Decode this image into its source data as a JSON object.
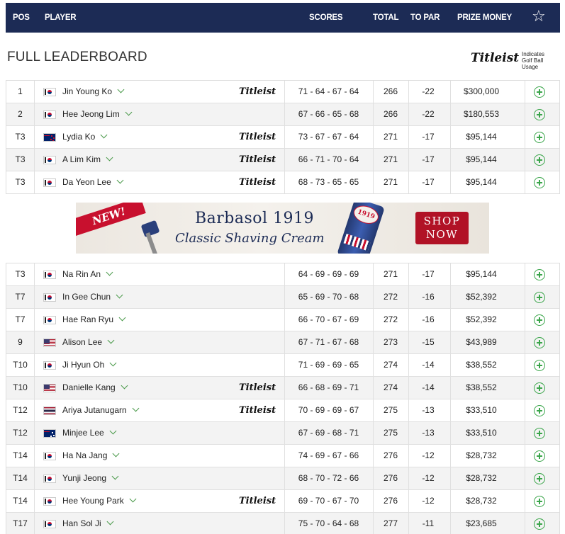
{
  "header": {
    "pos": "POS",
    "player": "PLAYER",
    "scores": "SCORES",
    "total": "TOTAL",
    "to_par": "TO PAR",
    "prize_money": "PRIZE MONEY",
    "favorite_icon": "star-outline-icon",
    "background": "#1c2b55"
  },
  "title": "FULL LEADERBOARD",
  "sponsor": {
    "logo_text": "Titleist",
    "note_line1": "Indicates",
    "note_line2": "Golf Ball Usage"
  },
  "accent_color": "#3aa54a",
  "leaderboard_top": [
    {
      "pos": "1",
      "flag": "kr",
      "name": "Jin Young Ko",
      "titleist": true,
      "scores": "71 - 64 - 67 - 64",
      "total": "266",
      "to_par": "-22",
      "prize": "$300,000"
    },
    {
      "pos": "2",
      "flag": "kr",
      "name": "Hee Jeong Lim",
      "titleist": false,
      "scores": "67 - 66 - 65 - 68",
      "total": "266",
      "to_par": "-22",
      "prize": "$180,553"
    },
    {
      "pos": "T3",
      "flag": "nz",
      "name": "Lydia Ko",
      "titleist": true,
      "scores": "73 - 67 - 67 - 64",
      "total": "271",
      "to_par": "-17",
      "prize": "$95,144"
    },
    {
      "pos": "T3",
      "flag": "kr",
      "name": "A Lim Kim",
      "titleist": true,
      "scores": "66 - 71 - 70 - 64",
      "total": "271",
      "to_par": "-17",
      "prize": "$95,144"
    },
    {
      "pos": "T3",
      "flag": "kr",
      "name": "Da Yeon Lee",
      "titleist": true,
      "scores": "68 - 73 - 65 - 65",
      "total": "271",
      "to_par": "-17",
      "prize": "$95,144"
    }
  ],
  "ad": {
    "ribbon": "NEW!",
    "brand": "Barbasol 1919",
    "tagline": "Classic Shaving Cream",
    "tube_label": "1919",
    "cta_line1": "SHOP",
    "cta_line2": "NOW"
  },
  "leaderboard_bottom": [
    {
      "pos": "T3",
      "flag": "kr",
      "name": "Na Rin An",
      "titleist": false,
      "scores": "64 - 69 - 69 - 69",
      "total": "271",
      "to_par": "-17",
      "prize": "$95,144"
    },
    {
      "pos": "T7",
      "flag": "kr",
      "name": "In Gee Chun",
      "titleist": false,
      "scores": "65 - 69 - 70 - 68",
      "total": "272",
      "to_par": "-16",
      "prize": "$52,392"
    },
    {
      "pos": "T7",
      "flag": "kr",
      "name": "Hae Ran Ryu",
      "titleist": false,
      "scores": "66 - 70 - 67 - 69",
      "total": "272",
      "to_par": "-16",
      "prize": "$52,392"
    },
    {
      "pos": "9",
      "flag": "us",
      "name": "Alison Lee",
      "titleist": false,
      "scores": "67 - 71 - 67 - 68",
      "total": "273",
      "to_par": "-15",
      "prize": "$43,989"
    },
    {
      "pos": "T10",
      "flag": "kr",
      "name": "Ji Hyun Oh",
      "titleist": false,
      "scores": "71 - 69 - 69 - 65",
      "total": "274",
      "to_par": "-14",
      "prize": "$38,552"
    },
    {
      "pos": "T10",
      "flag": "us",
      "name": "Danielle Kang",
      "titleist": true,
      "scores": "66 - 68 - 69 - 71",
      "total": "274",
      "to_par": "-14",
      "prize": "$38,552"
    },
    {
      "pos": "T12",
      "flag": "th",
      "name": "Ariya Jutanugarn",
      "titleist": true,
      "scores": "70 - 69 - 69 - 67",
      "total": "275",
      "to_par": "-13",
      "prize": "$33,510"
    },
    {
      "pos": "T12",
      "flag": "au",
      "name": "Minjee Lee",
      "titleist": false,
      "scores": "67 - 69 - 68 - 71",
      "total": "275",
      "to_par": "-13",
      "prize": "$33,510"
    },
    {
      "pos": "T14",
      "flag": "kr",
      "name": "Ha Na Jang",
      "titleist": false,
      "scores": "74 - 69 - 67 - 66",
      "total": "276",
      "to_par": "-12",
      "prize": "$28,732"
    },
    {
      "pos": "T14",
      "flag": "kr",
      "name": "Yunji Jeong",
      "titleist": false,
      "scores": "68 - 70 - 72 - 66",
      "total": "276",
      "to_par": "-12",
      "prize": "$28,732"
    },
    {
      "pos": "T14",
      "flag": "kr",
      "name": "Hee Young Park",
      "titleist": true,
      "scores": "69 - 70 - 67 - 70",
      "total": "276",
      "to_par": "-12",
      "prize": "$28,732"
    },
    {
      "pos": "T17",
      "flag": "kr",
      "name": "Han Sol Ji",
      "titleist": false,
      "scores": "75 - 70 - 64 - 68",
      "total": "277",
      "to_par": "-11",
      "prize": "$23,685"
    }
  ]
}
